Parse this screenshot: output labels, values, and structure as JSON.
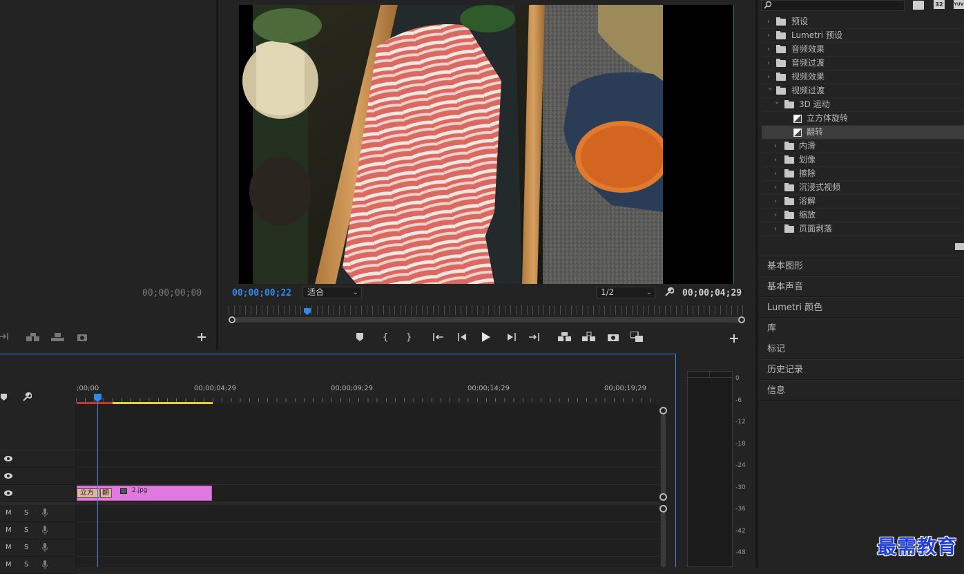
{
  "source_monitor": {
    "timecode": "00;00;00;00"
  },
  "program_monitor": {
    "current_timecode": "00;00;00;22",
    "fit_dropdown": "适合",
    "resolution_dropdown": "1/2",
    "duration_timecode": "00;00;04;29"
  },
  "effects_panel": {
    "toolbar_badges": [
      "32",
      "YUV"
    ],
    "items": [
      {
        "label": "预设",
        "level": 0,
        "type": "preset-folder",
        "expanded": false
      },
      {
        "label": "Lumetri 预设",
        "level": 0,
        "type": "preset-folder",
        "expanded": false
      },
      {
        "label": "音频效果",
        "level": 0,
        "type": "folder",
        "expanded": false
      },
      {
        "label": "音频过渡",
        "level": 0,
        "type": "folder",
        "expanded": false
      },
      {
        "label": "视频效果",
        "level": 0,
        "type": "folder",
        "expanded": false
      },
      {
        "label": "视频过渡",
        "level": 0,
        "type": "folder",
        "expanded": true
      },
      {
        "label": "3D 运动",
        "level": 1,
        "type": "folder",
        "expanded": true
      },
      {
        "label": "立方体旋转",
        "level": 2,
        "type": "transition"
      },
      {
        "label": "翻转",
        "level": 2,
        "type": "transition",
        "selected": true
      },
      {
        "label": "内滑",
        "level": 1,
        "type": "folder",
        "expanded": false
      },
      {
        "label": "划像",
        "level": 1,
        "type": "folder",
        "expanded": false
      },
      {
        "label": "擦除",
        "level": 1,
        "type": "folder",
        "expanded": false
      },
      {
        "label": "沉浸式视频",
        "level": 1,
        "type": "folder",
        "expanded": false
      },
      {
        "label": "溶解",
        "level": 1,
        "type": "folder",
        "expanded": false
      },
      {
        "label": "缩放",
        "level": 1,
        "type": "folder",
        "expanded": false
      },
      {
        "label": "页面剥落",
        "level": 1,
        "type": "folder",
        "expanded": false
      }
    ]
  },
  "side_panels": [
    "基本图形",
    "基本声音",
    "Lumetri 颜色",
    "库",
    "标记",
    "历史记录",
    "信息"
  ],
  "timeline": {
    "ruler_labels": [
      ";00;00",
      "00;00;04;29",
      "00;00;09;29",
      "00;00;14;29",
      "00;00;19;29"
    ],
    "clip_name": "2.jpg",
    "transition_label": "立方",
    "transition_label_2": "翻"
  },
  "audio_meter": {
    "scale": [
      "0",
      "-6",
      "-12",
      "-18",
      "-24",
      "-30",
      "-36",
      "-42",
      "-48"
    ]
  },
  "watermark": "最需教育",
  "colors": {
    "accent_blue": "#2d8ceb",
    "clip_pink": "#e07ae0",
    "transition_tan": "#d9b7a0",
    "work_area_yellow": "#e6d22e",
    "render_red": "#c8372c"
  }
}
